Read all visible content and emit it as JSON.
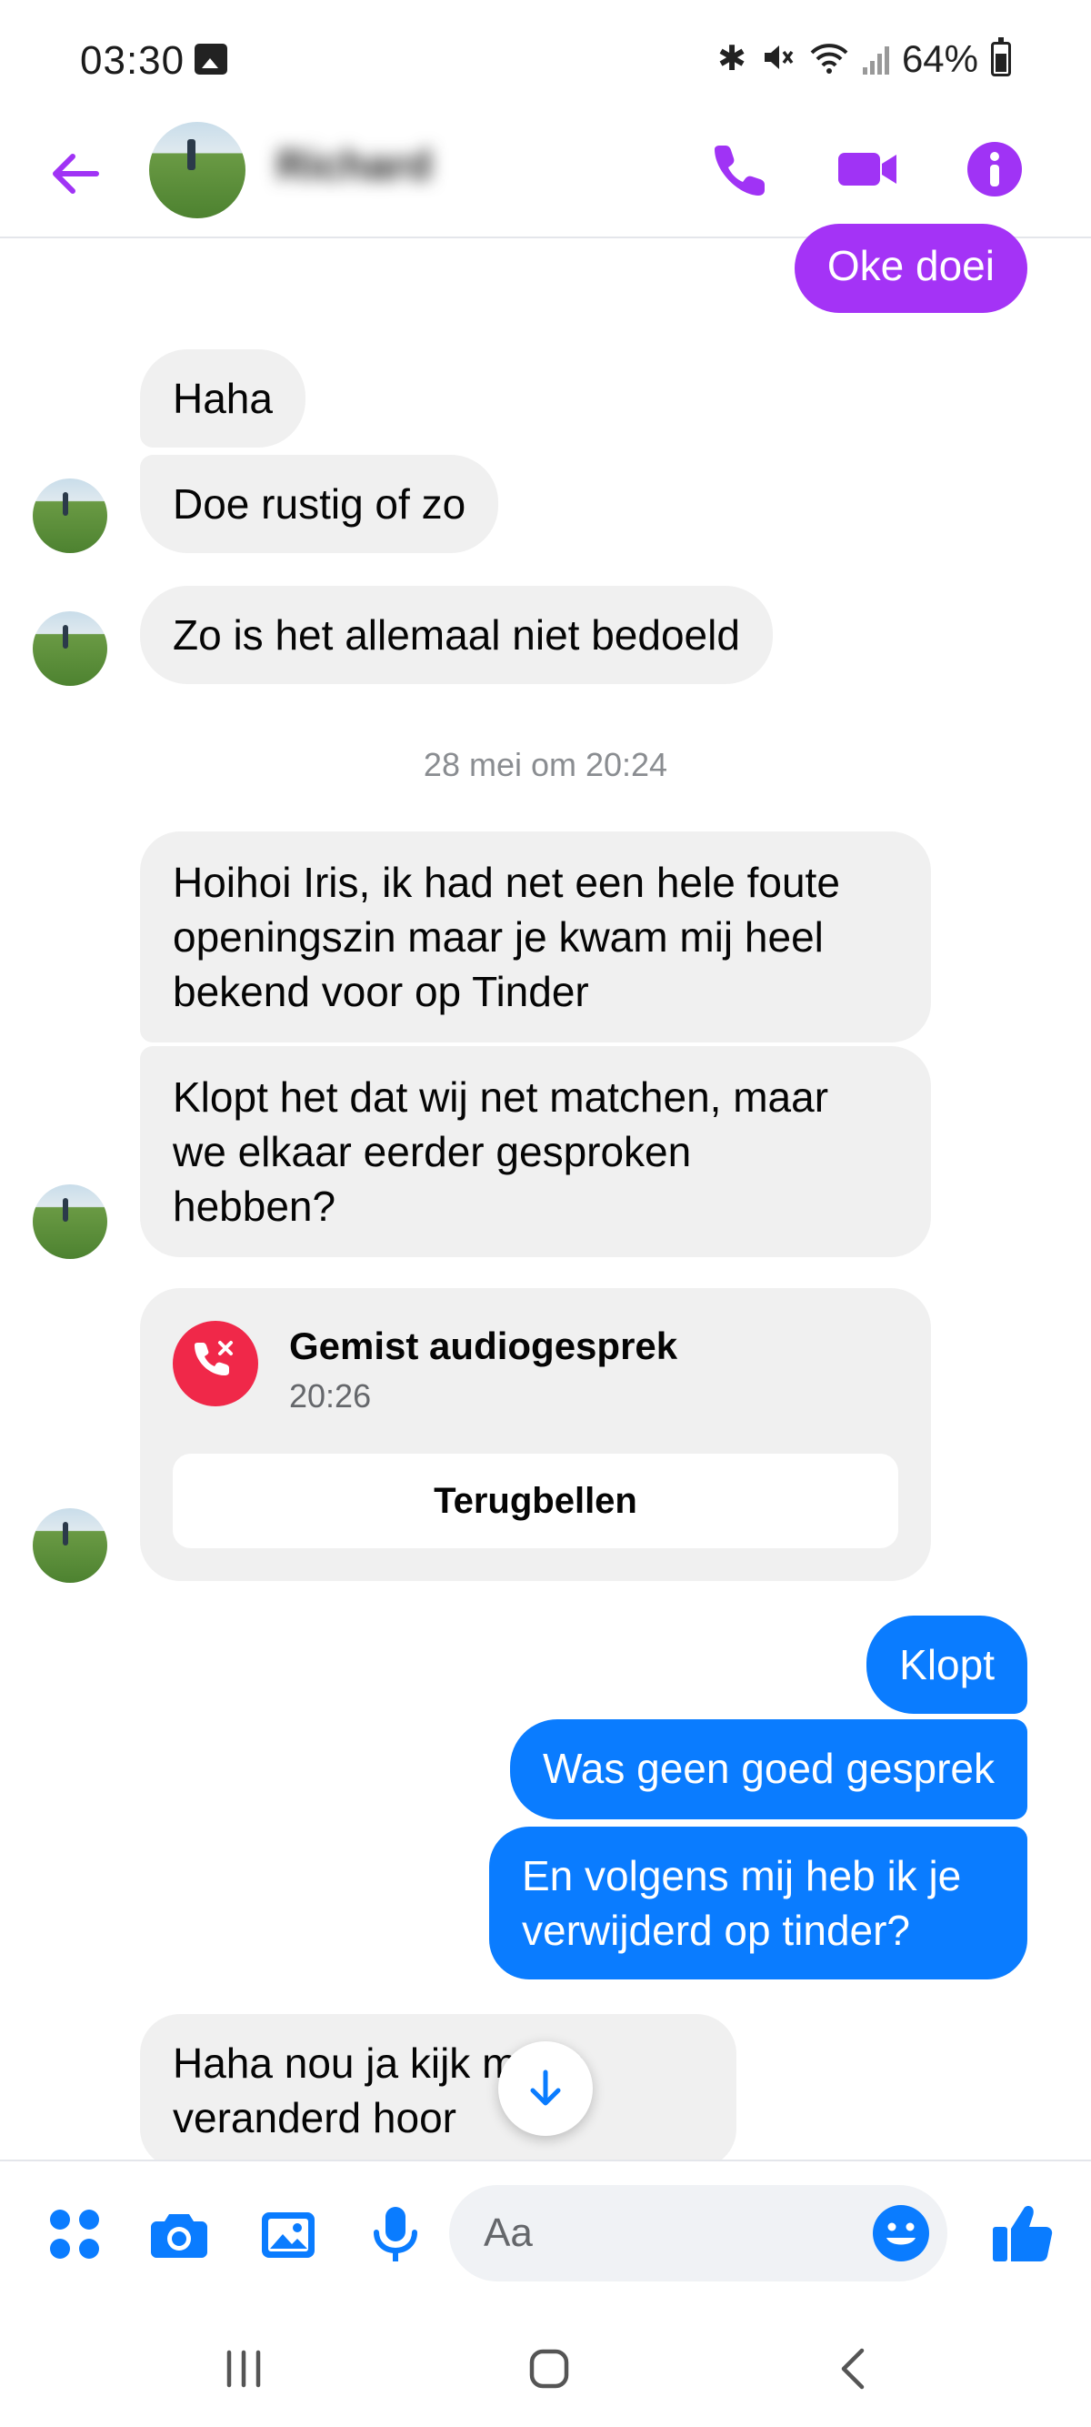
{
  "status_bar": {
    "time": "03:30",
    "battery": "64%",
    "icons": [
      "gallery-icon",
      "bluetooth-icon",
      "mute-icon",
      "wifi-icon",
      "signal-icon",
      "battery-icon"
    ]
  },
  "header": {
    "contact_name": "Richard",
    "icons": [
      "back-arrow-icon",
      "phone-icon",
      "video-camera-icon",
      "info-icon"
    ],
    "accent_color": "#a033f5"
  },
  "messages": [
    {
      "dir": "out",
      "text": "Oke doei"
    },
    {
      "dir": "in",
      "text": "Haha"
    },
    {
      "dir": "in",
      "text": "Doe rustig of zo"
    },
    {
      "dir": "in",
      "text": "Zo is het allemaal niet bedoeld"
    },
    {
      "dir": "in",
      "text": "Hoihoi Iris, ik had net een hele foute\nopeningszin maar je kwam mij heel\nbekend voor op Tinder"
    },
    {
      "dir": "in",
      "text": "Klopt het dat wij net matchen, maar\nwe elkaar eerder gesproken\nhebben?"
    },
    {
      "dir": "out",
      "text": "Klopt"
    },
    {
      "dir": "out",
      "text": "Was geen goed gesprek"
    },
    {
      "dir": "out",
      "text": "En volgens mij heb ik je\nverwijderd op tinder?"
    },
    {
      "dir": "in",
      "text": "Haha nou ja kijk      mens\nveranderd hoor"
    }
  ],
  "timestamp": "28 mei om 20:24",
  "missed_call": {
    "title": "Gemist audiogesprek",
    "time": "20:26",
    "callback_label": "Terugbellen"
  },
  "composer": {
    "placeholder": "Aa",
    "icons": [
      "menu-dots-icon",
      "camera-icon",
      "gallery-icon",
      "microphone-icon",
      "emoji-icon",
      "thumbs-up-icon"
    ],
    "accent_color": "#0a7cff"
  },
  "navbar": {
    "icons": [
      "recent-apps-icon",
      "home-icon",
      "back-icon"
    ]
  }
}
